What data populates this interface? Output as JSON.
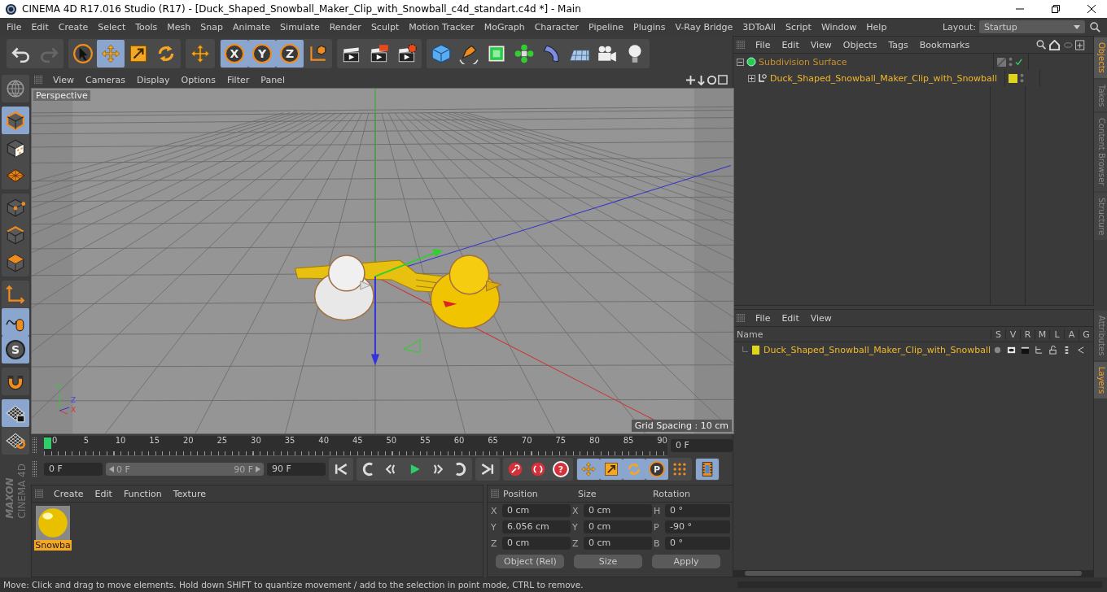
{
  "window": {
    "title": "CINEMA 4D R17.016 Studio (R17) - [Duck_Shaped_Snowball_Maker_Clip_with_Snowball_c4d_standart.c4d *] - Main"
  },
  "menu": [
    "File",
    "Edit",
    "Create",
    "Select",
    "Tools",
    "Mesh",
    "Snap",
    "Animate",
    "Simulate",
    "Render",
    "Sculpt",
    "Motion Tracker",
    "MoGraph",
    "Character",
    "Pipeline",
    "Plugins",
    "V-Ray Bridge",
    "3DToAll",
    "Script",
    "Window",
    "Help"
  ],
  "layout": {
    "label": "Layout:",
    "value": "Startup"
  },
  "toolbar": [
    [
      {
        "kind": "undo",
        "selected": false
      },
      {
        "kind": "redo",
        "selected": false
      }
    ],
    [
      {
        "kind": "select",
        "selected": false
      },
      {
        "kind": "move",
        "selected": true
      },
      {
        "kind": "scale",
        "selected": false
      },
      {
        "kind": "rotate",
        "selected": false
      }
    ],
    [
      {
        "kind": "move",
        "selected": false
      }
    ],
    [
      {
        "kind": "axis-lock",
        "label": "X",
        "selected": true
      },
      {
        "kind": "axis-lock",
        "label": "Y",
        "selected": true
      },
      {
        "kind": "axis-lock",
        "label": "Z",
        "selected": true
      },
      {
        "kind": "world-coord",
        "selected": false
      }
    ],
    [
      {
        "kind": "render-view",
        "selected": false
      },
      {
        "kind": "render-viewer",
        "selected": false
      },
      {
        "kind": "render-settings",
        "selected": false
      }
    ],
    [
      {
        "kind": "cube",
        "selected": false
      },
      {
        "kind": "pen",
        "selected": false
      },
      {
        "kind": "subdivision",
        "selected": false
      },
      {
        "kind": "cloner",
        "selected": false
      },
      {
        "kind": "deformer",
        "selected": false
      },
      {
        "kind": "floor",
        "selected": false
      },
      {
        "kind": "camera",
        "selected": false
      },
      {
        "kind": "light",
        "selected": false
      }
    ]
  ],
  "left_tools": [
    [
      {
        "kind": "make-editable",
        "selected": false
      }
    ],
    [
      {
        "kind": "model",
        "selected": true
      },
      {
        "kind": "texture",
        "selected": false
      },
      {
        "kind": "workplane",
        "selected": false
      }
    ],
    [
      {
        "kind": "points",
        "selected": false
      },
      {
        "kind": "edges",
        "selected": false
      },
      {
        "kind": "polygons",
        "selected": false
      }
    ],
    [
      {
        "kind": "axis",
        "selected": false
      },
      {
        "kind": "tweak",
        "selected": true
      },
      {
        "kind": "solo",
        "label": "S",
        "selected": true
      }
    ],
    [
      {
        "kind": "snap",
        "selected": false
      }
    ],
    [
      {
        "kind": "lock-workplane",
        "selected": true
      },
      {
        "kind": "planar-workplane",
        "selected": false
      }
    ]
  ],
  "brand": {
    "logo": "MAXON",
    "product": "CINEMA 4D"
  },
  "viewport": {
    "menu": [
      "View",
      "Cameras",
      "Display",
      "Options",
      "Filter",
      "Panel"
    ],
    "camera": "Perspective",
    "grid_spacing": "Grid Spacing : 10 cm",
    "axes": [
      "Y",
      "Z",
      "X"
    ]
  },
  "timeline": {
    "ticks": [
      "0",
      "5",
      "10",
      "15",
      "20",
      "25",
      "30",
      "35",
      "40",
      "45",
      "50",
      "55",
      "60",
      "65",
      "70",
      "75",
      "80",
      "85",
      "90"
    ],
    "playhead": {
      "level": 0
    },
    "current": "0 F",
    "start": "0 F",
    "range": {
      "start": "0 F",
      "end": "90 F",
      "level": 1
    },
    "end": "90 F",
    "buttons": [
      [
        {
          "kind": "to-start",
          "selected": false
        }
      ],
      [
        {
          "kind": "prev-key",
          "selected": false
        },
        {
          "kind": "prev-frame",
          "selected": false
        },
        {
          "kind": "play",
          "selected": false
        },
        {
          "kind": "next-frame",
          "selected": false
        },
        {
          "kind": "next-key",
          "selected": false
        }
      ],
      [
        {
          "kind": "to-end",
          "selected": false
        }
      ],
      [
        {
          "kind": "record",
          "selected": false
        },
        {
          "kind": "autokey",
          "selected": false
        },
        {
          "kind": "key-help",
          "label": "?",
          "selected": false
        }
      ],
      [
        {
          "kind": "move",
          "selected": true
        },
        {
          "kind": "scale",
          "selected": true
        },
        {
          "kind": "rotate",
          "selected": true
        },
        {
          "kind": "key-parameter",
          "label": "P",
          "selected": true
        },
        {
          "kind": "key-dots",
          "selected": false
        }
      ],
      [
        {
          "kind": "timeline-window",
          "selected": true
        }
      ]
    ]
  },
  "materials": {
    "menu": [
      "Create",
      "Edit",
      "Function",
      "Texture"
    ],
    "items": [
      {
        "name": "Snowba",
        "selected": true
      }
    ]
  },
  "coordinates": {
    "headers": [
      "Position",
      "Size",
      "Rotation"
    ],
    "rows": [
      [
        {
          "axis": "X",
          "value": "0 cm"
        },
        {
          "axis": "X",
          "value": "0 cm"
        },
        {
          "axis": "H",
          "value": "0 °"
        }
      ],
      [
        {
          "axis": "Y",
          "value": "6.056 cm"
        },
        {
          "axis": "Y",
          "value": "0 cm"
        },
        {
          "axis": "P",
          "value": "-90 °"
        }
      ],
      [
        {
          "axis": "Z",
          "value": "0 cm"
        },
        {
          "axis": "Z",
          "value": "0 cm"
        },
        {
          "axis": "B",
          "value": "0 °"
        }
      ]
    ],
    "mode": "Object (Rel)",
    "size_mode": "Size",
    "apply": "Apply"
  },
  "objects": {
    "menu": [
      "File",
      "Edit",
      "View",
      "Objects",
      "Tags",
      "Bookmarks"
    ],
    "tree": [
      {
        "name": "Subdivision Surface",
        "expanded": true,
        "children": [
          {
            "name": "Duck_Shaped_Snowball_Maker_Clip_with_Snowball",
            "expanded": false,
            "color": "#e0d41c"
          }
        ]
      }
    ]
  },
  "side_tabs_top": [
    {
      "label": "Objects",
      "selected": true
    },
    {
      "label": "Takes",
      "selected": false
    },
    {
      "label": "Content Browser",
      "selected": false
    },
    {
      "label": "Structure",
      "selected": false
    }
  ],
  "layers": {
    "menu": [
      "File",
      "Edit",
      "View"
    ],
    "columns": [
      "Name",
      "S",
      "V",
      "R",
      "M",
      "L",
      "A",
      "G"
    ],
    "rows": [
      {
        "name": "Duck_Shaped_Snowball_Maker_Clip_with_Snowball",
        "color": "#e0d41c"
      }
    ]
  },
  "side_tabs_bottom": [
    {
      "label": "Attributes",
      "selected": false
    },
    {
      "label": "Layers",
      "selected": true
    }
  ],
  "status": "Move: Click and drag to move elements. Hold down SHIFT to quantize movement / add to the selection in point mode, CTRL to remove."
}
